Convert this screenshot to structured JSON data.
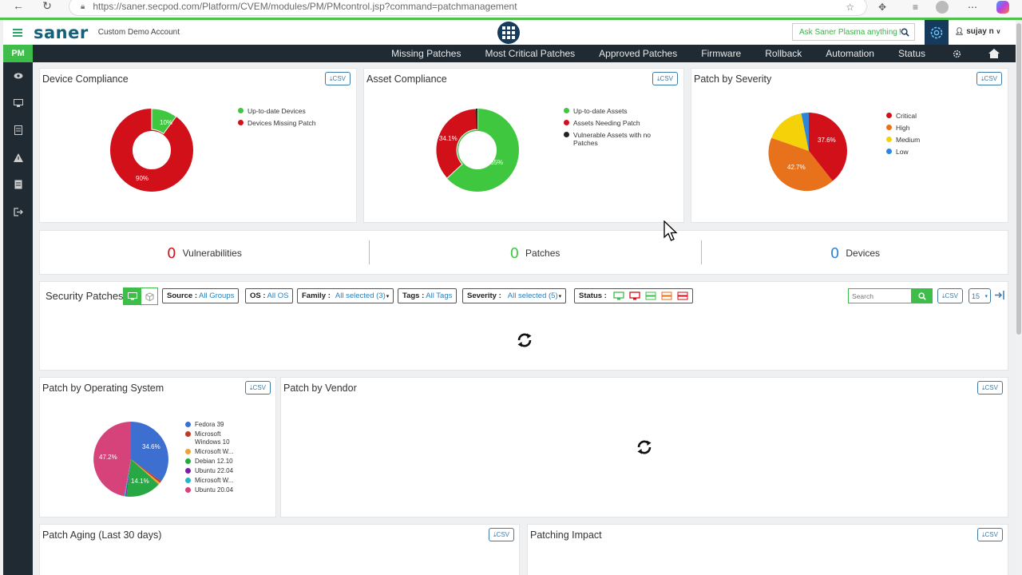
{
  "browser": {
    "url": "https://saner.secpod.com/Platform/CVEM/modules/PM/PMcontrol.jsp?command=patchmanagement"
  },
  "header": {
    "logo": "saner",
    "account": "Custom Demo Account",
    "ask_prefix": "Ask Saner Plasma anything",
    "ask_suffix": "!",
    "user": "sujay n"
  },
  "rail": {
    "pm_label": "PM"
  },
  "nav": {
    "items": [
      "Missing Patches",
      "Most Critical Patches",
      "Approved Patches",
      "Firmware",
      "Rollback",
      "Automation",
      "Status"
    ]
  },
  "csv_label": "CSV",
  "device_compliance": {
    "title": "Device Compliance",
    "legend": [
      "Up-to-date Devices",
      "Devices Missing Patch"
    ],
    "labels": [
      "10%",
      "90%"
    ]
  },
  "asset_compliance": {
    "title": "Asset Compliance",
    "legend": [
      "Up-to-date Assets",
      "Assets Needing Patch",
      "Vulnerable Assets with no Patches"
    ],
    "labels": [
      "65%",
      "34.1%"
    ]
  },
  "patch_severity": {
    "title": "Patch by Severity",
    "legend": [
      "Critical",
      "High",
      "Medium",
      "Low"
    ],
    "labels": [
      "37.6%",
      "42.7%"
    ]
  },
  "counters": {
    "vulnerabilities": {
      "value": "0",
      "label": "Vulnerabilities"
    },
    "patches": {
      "value": "0",
      "label": "Patches"
    },
    "devices": {
      "value": "0",
      "label": "Devices"
    }
  },
  "security_patches": {
    "title": "Security Patches",
    "source_label": "Source :",
    "source_value": "All Groups",
    "os_label": "OS :",
    "os_value": "All OS",
    "family_label": "Family :",
    "family_value": "All selected (3)",
    "tags_label": "Tags :",
    "tags_value": "All Tags",
    "severity_label": "Severity :",
    "severity_value": "All selected (5)",
    "status_label": "Status :",
    "search_placeholder": "Search",
    "page_size": "15"
  },
  "patch_os": {
    "title": "Patch by Operating System",
    "legend": [
      "Fedora 39",
      "Microsoft Windows 10",
      "Microsoft W...",
      "Debian 12.10",
      "Ubuntu 22.04",
      "Microsoft W...",
      "Ubuntu 20.04"
    ],
    "labels": [
      "34.6%",
      "14.1%",
      "47.2%"
    ]
  },
  "patch_vendor": {
    "title": "Patch by Vendor"
  },
  "patch_aging": {
    "title": "Patch Aging (Last 30 days)"
  },
  "patching_impact": {
    "title": "Patching Impact"
  },
  "colors": {
    "green": "#3fc83f",
    "red": "#d2101a",
    "black": "#222222",
    "orange": "#e8721c",
    "yellow": "#f5d10a",
    "blue": "#2f86d8",
    "fedora": "#3d6fd1",
    "win10": "#c0392b",
    "winw": "#e8a33a",
    "debian": "#27a844",
    "ubuntu22": "#7b1fa2",
    "winw2": "#2bb5c4",
    "ubuntu20": "#d6427a",
    "nav_bg": "#1f2a33",
    "accent": "#3fbd4b"
  }
}
